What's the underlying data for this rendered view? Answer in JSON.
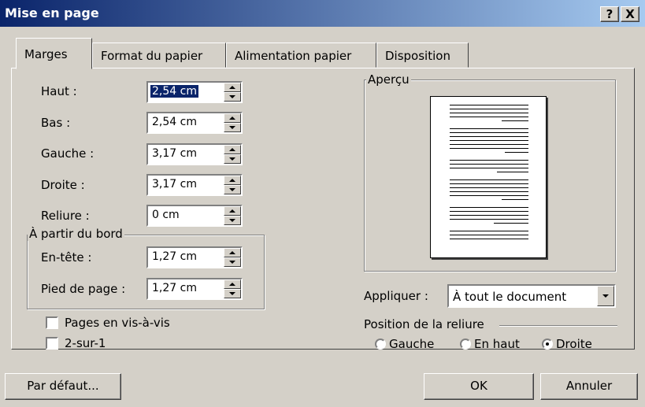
{
  "window": {
    "title": "Mise en page",
    "help": "?",
    "close": "X"
  },
  "tabs": [
    "Marges",
    "Format du papier",
    "Alimentation papier",
    "Disposition"
  ],
  "fields": {
    "haut": {
      "label": "Haut :",
      "value": "2,54 cm"
    },
    "bas": {
      "label": "Bas :",
      "value": "2,54 cm"
    },
    "gauche": {
      "label": "Gauche :",
      "value": "3,17 cm"
    },
    "droite": {
      "label": "Droite :",
      "value": "3,17 cm"
    },
    "reliure": {
      "label": "Reliure :",
      "value": "0 cm"
    }
  },
  "bord": {
    "legend": "À partir du bord",
    "entete": {
      "label": "En-tête :",
      "value": "1,27 cm"
    },
    "pied": {
      "label": "Pied de page :",
      "value": "1,27 cm"
    }
  },
  "checks": {
    "vis_a_vis": "Pages en vis-à-vis",
    "deux_sur_un": "2-sur-1"
  },
  "apercu": {
    "legend": "Aperçu"
  },
  "appliquer": {
    "label": "Appliquer :",
    "value": "À tout le document"
  },
  "position": {
    "legend": "Position de la reliure",
    "options": [
      "Gauche",
      "En haut",
      "Droite"
    ],
    "selected": "Droite"
  },
  "buttons": {
    "defaut": "Par défaut...",
    "ok": "OK",
    "annuler": "Annuler"
  }
}
